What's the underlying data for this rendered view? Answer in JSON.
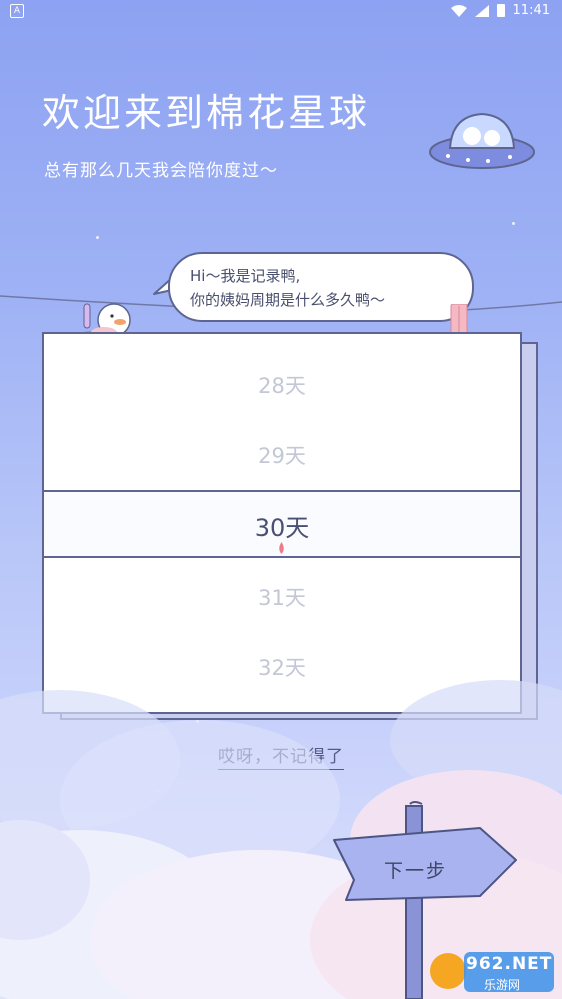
{
  "status_bar": {
    "time": "11:41",
    "app_indicator": "A"
  },
  "header": {
    "title": "欢迎来到棉花星球",
    "subtitle": "总有那么几天我会陪你度过～"
  },
  "bubble": {
    "line1": "Hi～我是记录鸭,",
    "line2": "你的姨妈周期是什么多久鸭～"
  },
  "picker": {
    "items": [
      "28天",
      "29天",
      "30天",
      "31天",
      "32天"
    ],
    "selected": "30天"
  },
  "forgot_link": "哎呀，不记得了",
  "next_button": "下一步",
  "watermark": {
    "brand": "962.NET",
    "sub": "乐游网"
  },
  "colors": {
    "accent_outline": "#5d6590",
    "sky_top": "#8da2f2",
    "drop": "#f07a8a"
  },
  "icons": [
    "wifi-icon",
    "signal-icon",
    "battery-icon",
    "ufo-illustration",
    "duck-mascot",
    "clothespin-icon",
    "drop-icon",
    "signpost"
  ]
}
